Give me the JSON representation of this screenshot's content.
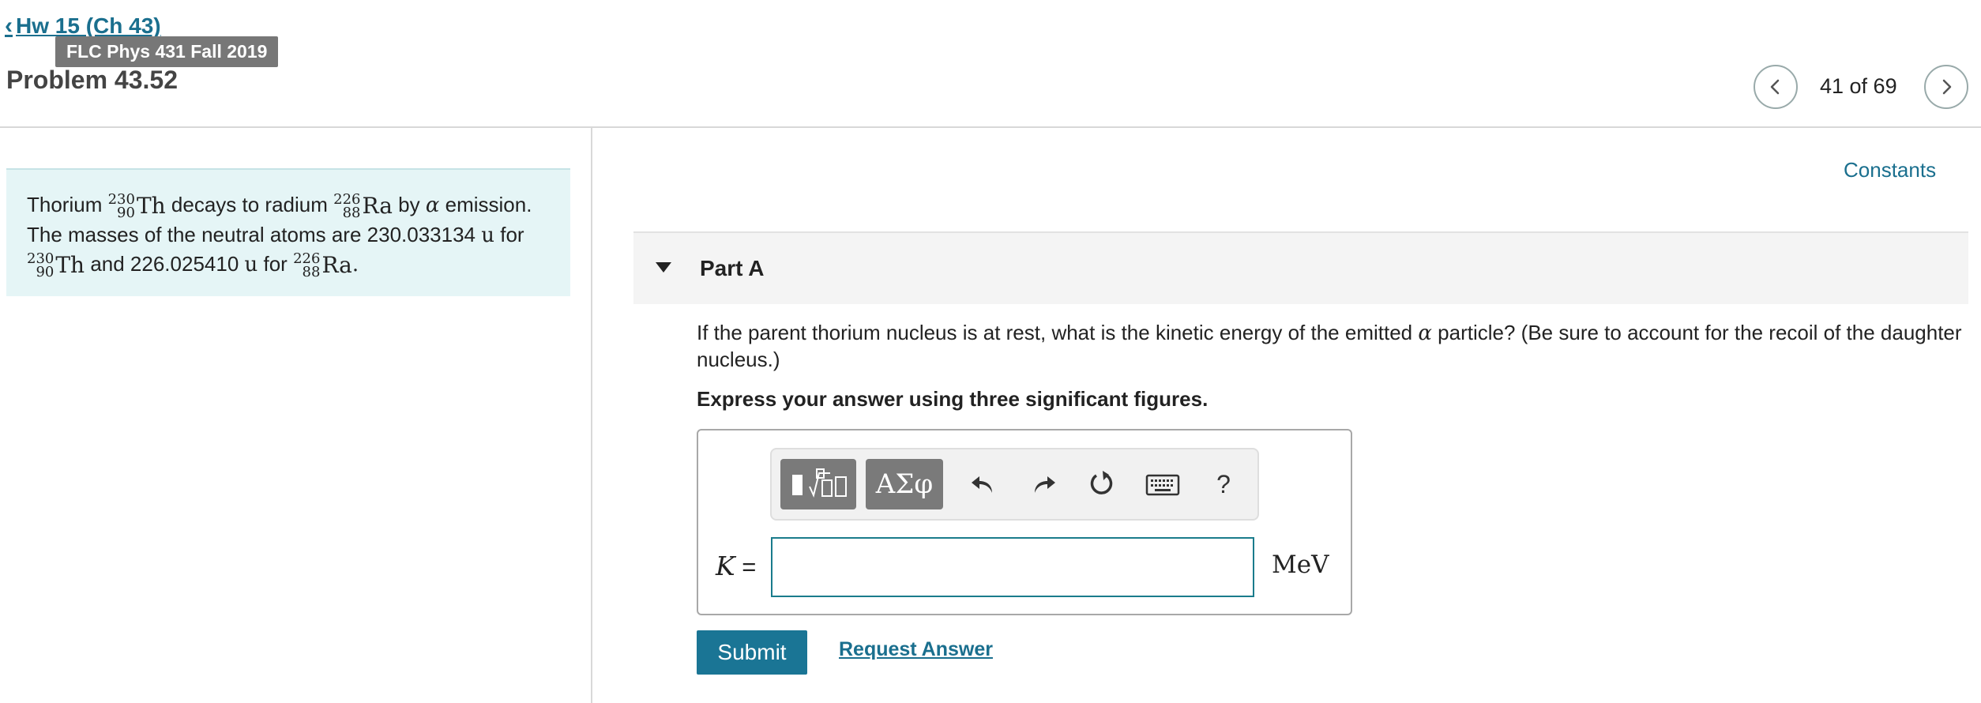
{
  "header": {
    "back_link": "Hw 15 (Ch 43)",
    "course_tooltip": "FLC Phys 431 Fall 2019",
    "problem_title": "Problem 43.52",
    "pagination": "41 of 69"
  },
  "intro": {
    "t1": "Thorium",
    "t2": "decays to radium",
    "t3": "by",
    "t4": "emission.",
    "t5": "The masses of the neutral atoms are 230.033134",
    "t6": "for",
    "t7": "and 226.025410",
    "t8": "for",
    "alpha": "α",
    "unit_u": "u",
    "thorium": {
      "mass_number": "230",
      "atomic_number": "90",
      "symbol": "Th"
    },
    "radium": {
      "mass_number": "226",
      "atomic_number": "88",
      "symbol": "Ra"
    }
  },
  "constants_link": "Constants",
  "part": {
    "label": "Part A",
    "question_a": "If the parent thorium nucleus is at rest, what is the kinetic energy of the emitted",
    "question_b": "particle? (Be sure to account for the recoil of the daughter nucleus.)",
    "alpha": "α",
    "instruction": "Express your answer using three significant figures."
  },
  "answer": {
    "variable": "K",
    "equals": "=",
    "value": "",
    "unit": "MeV",
    "greek_button": "ΑΣφ",
    "help_button": "?"
  },
  "buttons": {
    "submit": "Submit",
    "request_answer": "Request Answer"
  },
  "icons": [
    "chevron-left-icon",
    "chevron-right-icon",
    "templates-icon",
    "undo-icon",
    "redo-icon",
    "reset-icon",
    "keyboard-icon"
  ],
  "colors": {
    "accent": "#1a6f8e",
    "submit_bg": "#1a7595",
    "intro_bg": "#e5f5f6",
    "toolbar_button_bg": "#7a7a7a"
  }
}
